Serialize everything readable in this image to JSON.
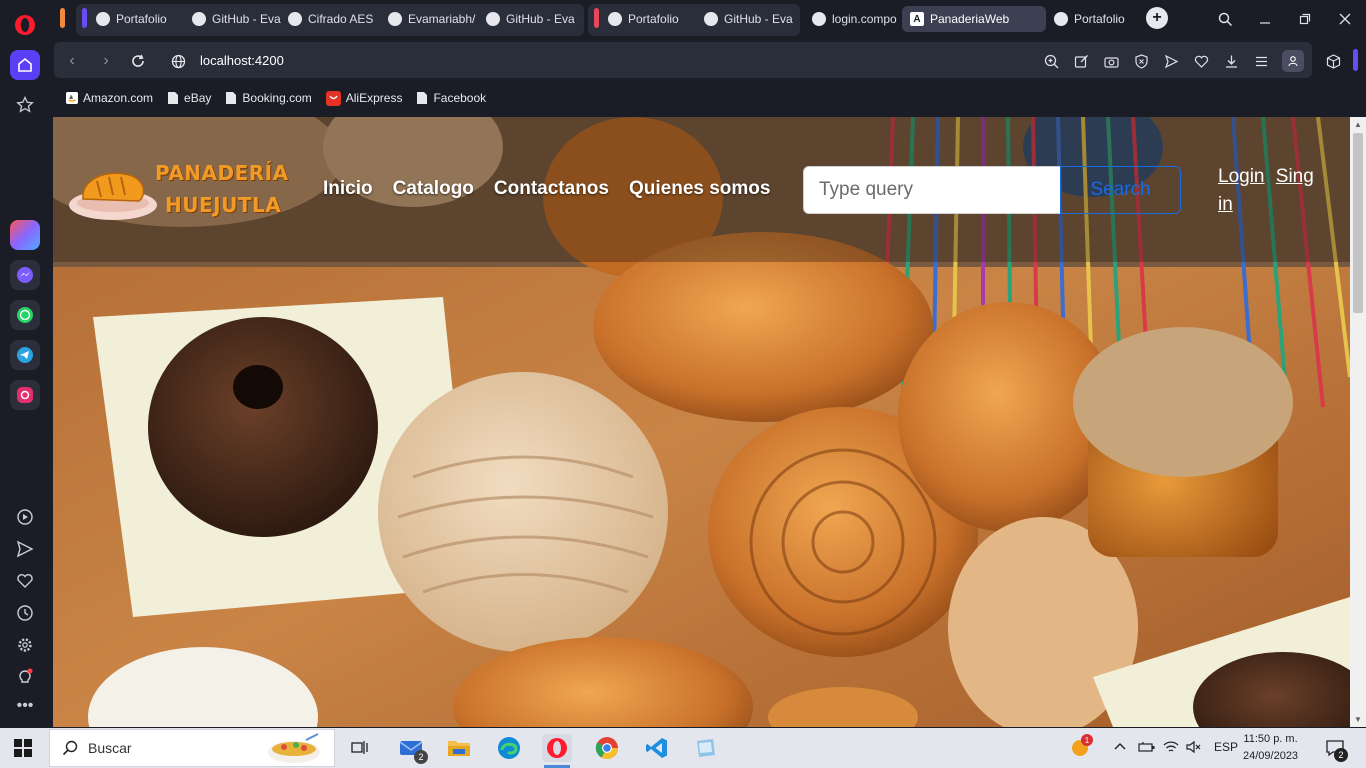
{
  "browser": {
    "tabs": [
      {
        "label": "Portafolio",
        "icon": "globe-icon"
      },
      {
        "label": "GitHub - Eva",
        "icon": "github-icon"
      },
      {
        "label": "Cifrado AES",
        "icon": "globe-icon"
      },
      {
        "label": "Evamariabh/",
        "icon": "github-icon"
      },
      {
        "label": "GitHub - Eva",
        "icon": "github-icon"
      },
      {
        "label": "Portafolio",
        "icon": "globe-icon"
      },
      {
        "label": "GitHub - Eva",
        "icon": "github-icon"
      },
      {
        "label": "login.compo",
        "icon": "globe-icon"
      },
      {
        "label": "PanaderiaWeb",
        "icon": "angular-icon"
      },
      {
        "label": "Portafolio",
        "icon": "globe-icon"
      }
    ],
    "new_tab_label": "+",
    "url": "localhost:4200",
    "bookmarks": [
      {
        "label": "Amazon.com"
      },
      {
        "label": "eBay"
      },
      {
        "label": "Booking.com"
      },
      {
        "label": "AliExpress"
      },
      {
        "label": "Facebook"
      }
    ],
    "accent": "#5b3ff5"
  },
  "page": {
    "logo": {
      "line1": "PANADERÍA",
      "line2": "HUEJUTLA"
    },
    "menu": [
      {
        "label": "Inicio"
      },
      {
        "label": "Catalogo"
      },
      {
        "label": "Contactanos"
      },
      {
        "label": "Quienes somos"
      }
    ],
    "search": {
      "placeholder": "Type query",
      "button_label": "Search"
    },
    "auth": {
      "login_label": "Login",
      "signin_label": "Sing in"
    },
    "colors": {
      "logo_orange": "#f29a26",
      "search_blue": "#1a6ae0"
    }
  },
  "taskbar": {
    "search_label": "Buscar",
    "mail_badge": "2",
    "language": "ESP",
    "time": "11:50 p. m.",
    "date": "24/09/2023",
    "notification_count": "2",
    "weather_badge": "1"
  }
}
